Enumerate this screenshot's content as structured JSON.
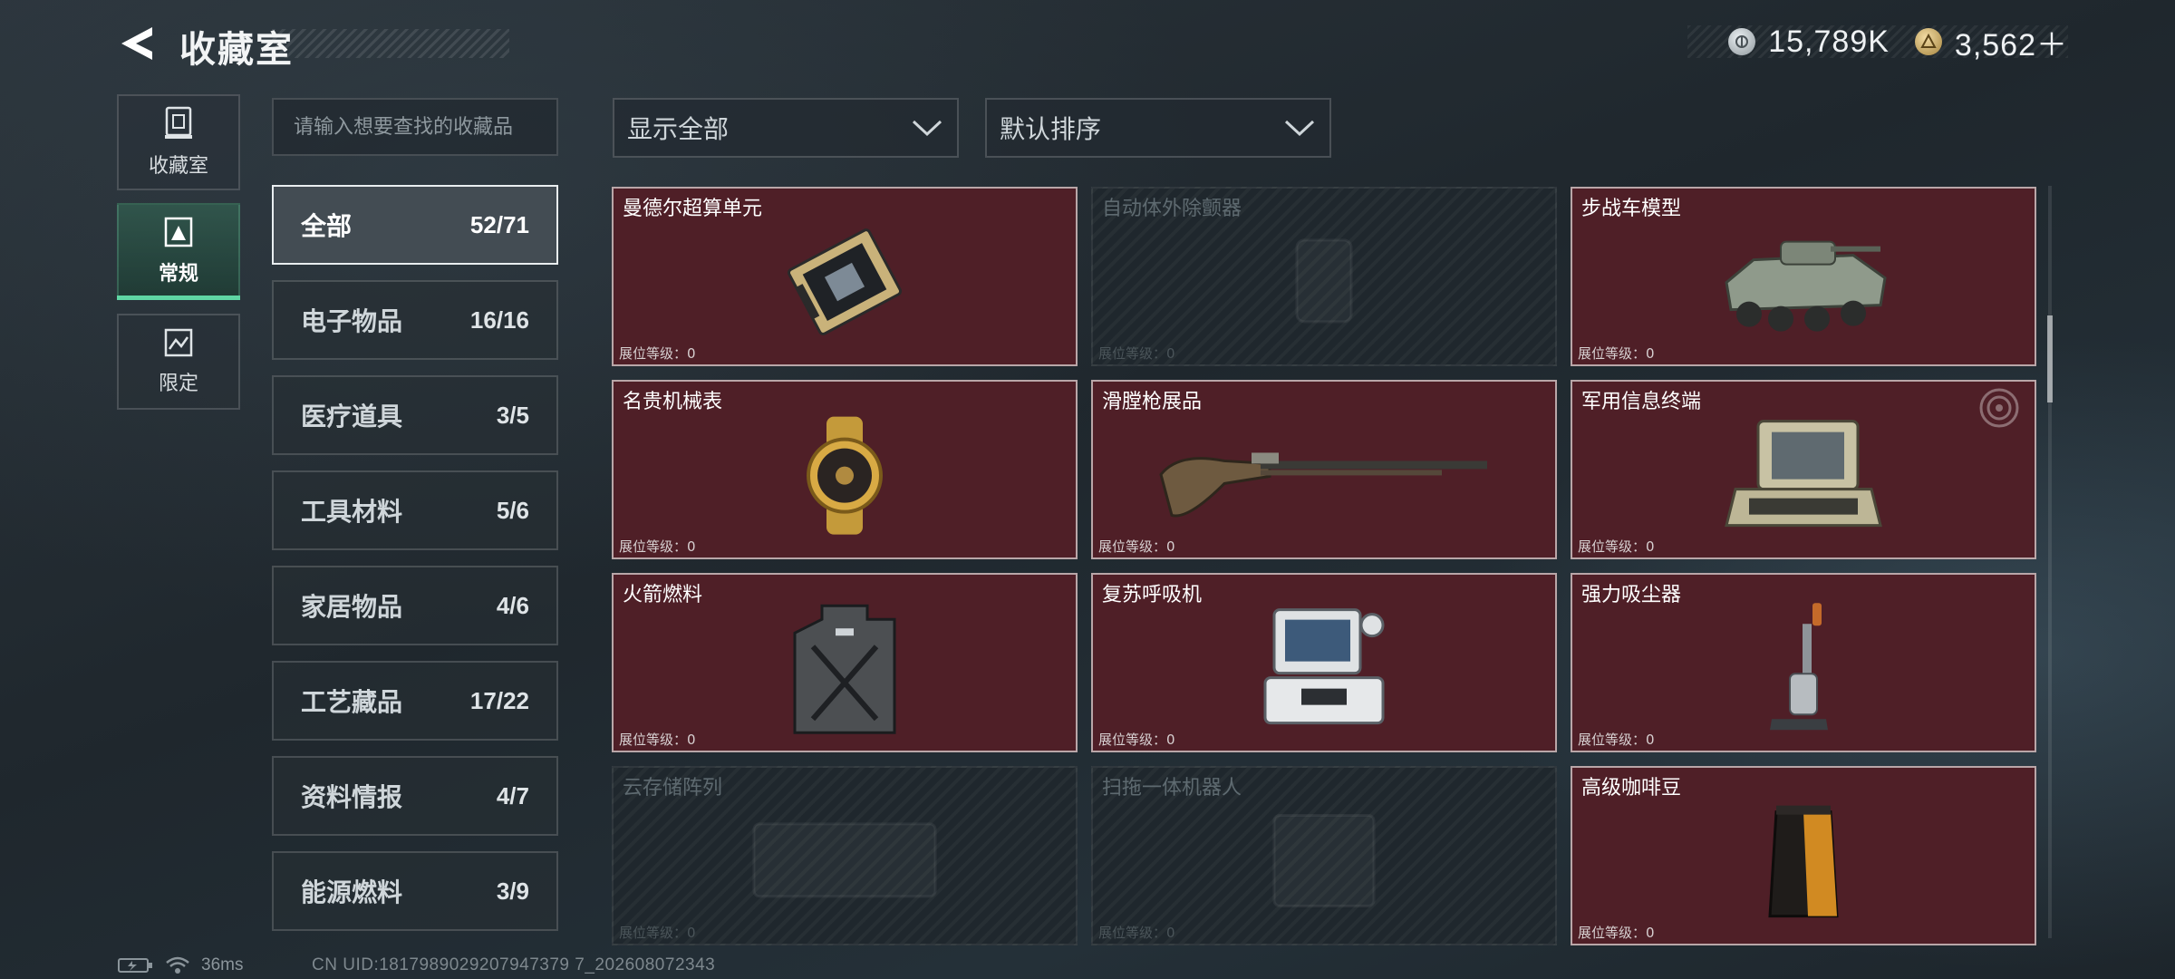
{
  "header": {
    "title": "收藏室",
    "currencies": [
      {
        "icon": "silver-coin-icon",
        "value": "15,789K"
      },
      {
        "icon": "gold-triangle-coin-icon",
        "value": "3,562＋"
      }
    ]
  },
  "rail": {
    "items": [
      {
        "label": "收藏室",
        "icon": "collection-room-icon",
        "active": false
      },
      {
        "label": "常规",
        "icon": "regular-collection-icon",
        "active": true
      },
      {
        "label": "限定",
        "icon": "limited-collection-icon",
        "active": false
      }
    ]
  },
  "search": {
    "placeholder": "请输入想要查找的收藏品"
  },
  "categories": [
    {
      "name": "全部",
      "count": "52/71",
      "active": true
    },
    {
      "name": "电子物品",
      "count": "16/16"
    },
    {
      "name": "医疗道具",
      "count": "3/5"
    },
    {
      "name": "工具材料",
      "count": "5/6"
    },
    {
      "name": "家居物品",
      "count": "4/6"
    },
    {
      "name": "工艺藏品",
      "count": "17/22"
    },
    {
      "name": "资料情报",
      "count": "4/7"
    },
    {
      "name": "能源燃料",
      "count": "3/9"
    }
  ],
  "filters": {
    "show": "显示全部",
    "sort": "默认排序"
  },
  "items": [
    {
      "name": "曼德尔超算单元",
      "level": "展位等级：0",
      "owned": true,
      "icon": "supercomputer-unit-icon"
    },
    {
      "name": "自动体外除颤器",
      "level": "展位等级：0",
      "owned": false,
      "icon": "defibrillator-icon"
    },
    {
      "name": "步战车模型",
      "level": "展位等级：0",
      "owned": true,
      "icon": "ifv-model-icon"
    },
    {
      "name": "名贵机械表",
      "level": "展位等级：0",
      "owned": true,
      "icon": "mechanical-watch-icon"
    },
    {
      "name": "滑膛枪展品",
      "level": "展位等级：0",
      "owned": true,
      "icon": "musket-icon"
    },
    {
      "name": "军用信息终端",
      "level": "展位等级：0",
      "owned": true,
      "icon": "military-terminal-icon"
    },
    {
      "name": "火箭燃料",
      "level": "展位等级：0",
      "owned": true,
      "icon": "fuel-canister-icon"
    },
    {
      "name": "复苏呼吸机",
      "level": "展位等级：0",
      "owned": true,
      "icon": "ventilator-icon"
    },
    {
      "name": "强力吸尘器",
      "level": "展位等级：0",
      "owned": true,
      "icon": "vacuum-cleaner-icon"
    },
    {
      "name": "云存储阵列",
      "level": "展位等级：0",
      "owned": false,
      "icon": "storage-array-icon"
    },
    {
      "name": "扫拖一体机器人",
      "level": "展位等级：0",
      "owned": false,
      "icon": "robot-vacuum-icon"
    },
    {
      "name": "高级咖啡豆",
      "level": "展位等级：0",
      "owned": true,
      "icon": "coffee-bag-icon"
    }
  ],
  "footer": {
    "ping": "36ms",
    "uid": "CN UID:1817989029207947379 7_202608072343"
  }
}
